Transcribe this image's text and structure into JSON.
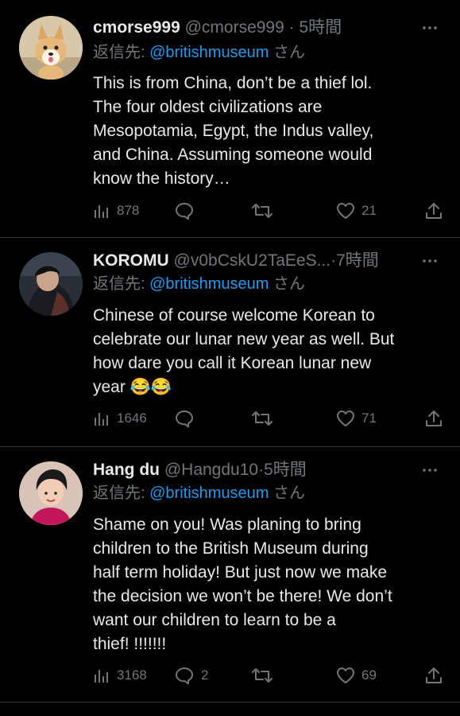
{
  "tweets": [
    {
      "name": "cmorse999",
      "handle": "@cmorse999",
      "separator": "·",
      "time": "5時間",
      "reply_label": "返信先: ",
      "reply_to": "@britishmuseum",
      "reply_suffix": " さん",
      "text": "This is from China, don’t be a thief lol.\nThe four oldest civilizations are\nMesopotamia, Egypt, the Indus valley,\nand China. Assuming someone would\nknow the history…",
      "views": "878",
      "replies": "",
      "retweets": "",
      "likes": "21",
      "avatar": "corgi-dog-avatar"
    },
    {
      "name": "KOROMU",
      "handle": "@v0bCskU2TaEeS...",
      "separator": "·",
      "time": "7時間",
      "reply_label": "返信先: ",
      "reply_to": "@britishmuseum",
      "reply_suffix": " さん",
      "text": "Chinese of course welcome Korean to\ncelebrate our lunar new year as well. But\nhow dare you call it Korean lunar new\nyear ",
      "emoji": "😂😂",
      "views": "1646",
      "replies": "",
      "retweets": "",
      "likes": "71",
      "avatar": "anime-avatar"
    },
    {
      "name": "Hang du",
      "handle": "@Hangdu10",
      "separator": "·",
      "time": "5時間",
      "reply_label": "返信先: ",
      "reply_to": "@britishmuseum",
      "reply_suffix": " さん",
      "text": "Shame on you! Was planing to bring\nchildren to the British Museum during\nhalf term holiday! But just now we make\nthe decision we won’t be there! We don’t\nwant our children to learn to be a\nthief! !!!!!!!",
      "views": "3168",
      "replies": "2",
      "retweets": "",
      "likes": "69",
      "avatar": "person-avatar"
    }
  ],
  "colors": {
    "background": "#000000",
    "text": "#e7e9ea",
    "muted": "#71767b",
    "link": "#1d9bf0",
    "divider": "#2f3336"
  }
}
